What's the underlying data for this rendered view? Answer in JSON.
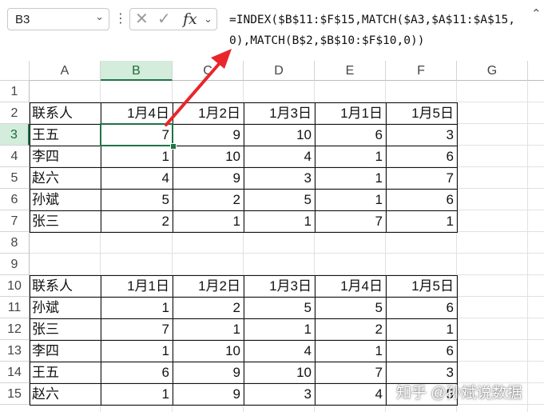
{
  "formula_bar": {
    "name_box": "B3",
    "formula_line1": "=INDEX($B$11:$F$15,MATCH($A3,$A$11:$A$15,",
    "formula_line2": "0),MATCH(B$2,$B$10:$F$10,0))",
    "cancel_icon": "close-icon",
    "enter_icon": "check-icon",
    "fx_label": "fx"
  },
  "columns": [
    "A",
    "B",
    "C",
    "D",
    "E",
    "F",
    "G"
  ],
  "rows": [
    "1",
    "2",
    "3",
    "4",
    "5",
    "6",
    "7",
    "8",
    "9",
    "10",
    "11",
    "12",
    "13",
    "14",
    "15"
  ],
  "selected": {
    "col": "B",
    "row": "3"
  },
  "table1": {
    "headers": [
      "联系人",
      "1月4日",
      "1月2日",
      "1月3日",
      "1月1日",
      "1月5日"
    ],
    "rows": [
      {
        "name": "王五",
        "values": [
          "7",
          "9",
          "10",
          "6",
          "3"
        ]
      },
      {
        "name": "李四",
        "values": [
          "1",
          "10",
          "4",
          "1",
          "6"
        ]
      },
      {
        "name": "赵六",
        "values": [
          "4",
          "9",
          "3",
          "1",
          "7"
        ]
      },
      {
        "name": "孙斌",
        "values": [
          "5",
          "2",
          "5",
          "1",
          "6"
        ]
      },
      {
        "name": "张三",
        "values": [
          "2",
          "1",
          "1",
          "7",
          "1"
        ]
      }
    ]
  },
  "table2": {
    "headers": [
      "联系人",
      "1月1日",
      "1月2日",
      "1月3日",
      "1月4日",
      "1月5日"
    ],
    "rows": [
      {
        "name": "孙斌",
        "values": [
          "1",
          "2",
          "5",
          "5",
          "6"
        ]
      },
      {
        "name": "张三",
        "values": [
          "7",
          "1",
          "1",
          "2",
          "1"
        ]
      },
      {
        "name": "李四",
        "values": [
          "1",
          "10",
          "4",
          "1",
          "6"
        ]
      },
      {
        "name": "王五",
        "values": [
          "6",
          "9",
          "10",
          "7",
          "3"
        ]
      },
      {
        "name": "赵六",
        "values": [
          "1",
          "9",
          "3",
          "4",
          "5"
        ]
      }
    ]
  },
  "watermark": "知乎 @孙斌说数据",
  "colors": {
    "accent": "#217346",
    "header_selected_bg": "#d3ecdb",
    "arrow": "#e8262b"
  }
}
